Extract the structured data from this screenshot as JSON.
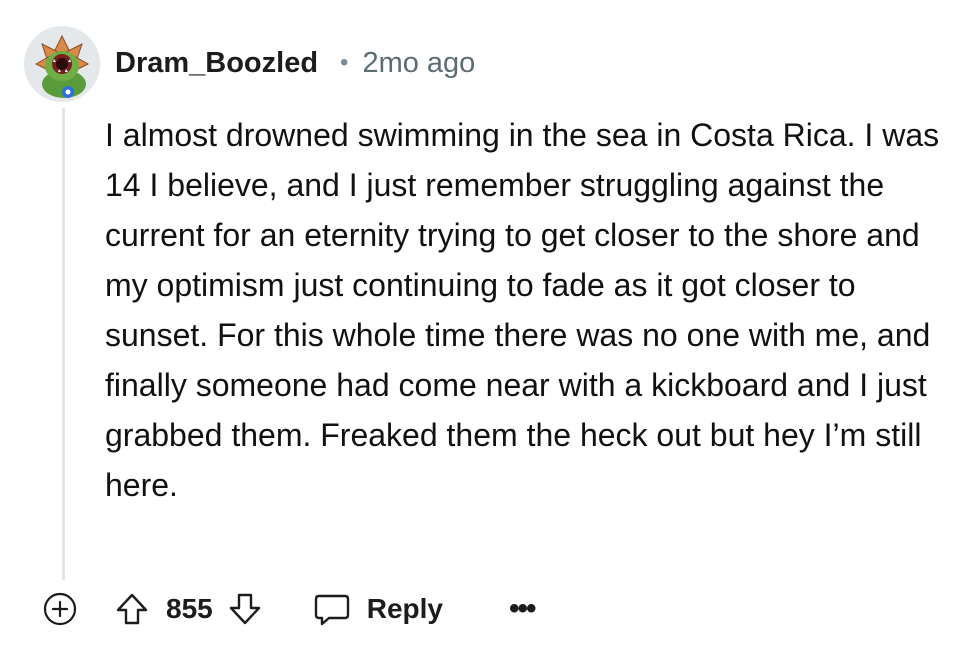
{
  "comment": {
    "username": "Dram_Boozled",
    "separator": "•",
    "timestamp": "2mo ago",
    "body": "I almost drowned swimming in the sea in Costa Rica. I was 14 I believe, and I just remember struggling against the current for an eternity trying to get closer to the shore and my optimism just continuing to fade as it got closer to sunset. For this whole time there was no one with me, and finally someone had come near with a kickboard and I just grabbed them. Freaked them the heck out but hey I’m still here.",
    "vote_count": "855",
    "reply_label": "Reply",
    "more_label": "•••"
  },
  "icons": {
    "avatar": "demogorgon-avatar",
    "expand": "plus-circle-icon",
    "upvote": "arrow-up-icon",
    "downvote": "arrow-down-icon",
    "reply": "speech-bubble-icon",
    "more": "ellipsis-icon"
  },
  "colors": {
    "text": "#1a1a1b",
    "muted": "#5c6c74",
    "thread_line": "#dfe4e7",
    "avatar_bg": "#e4e8ea"
  }
}
